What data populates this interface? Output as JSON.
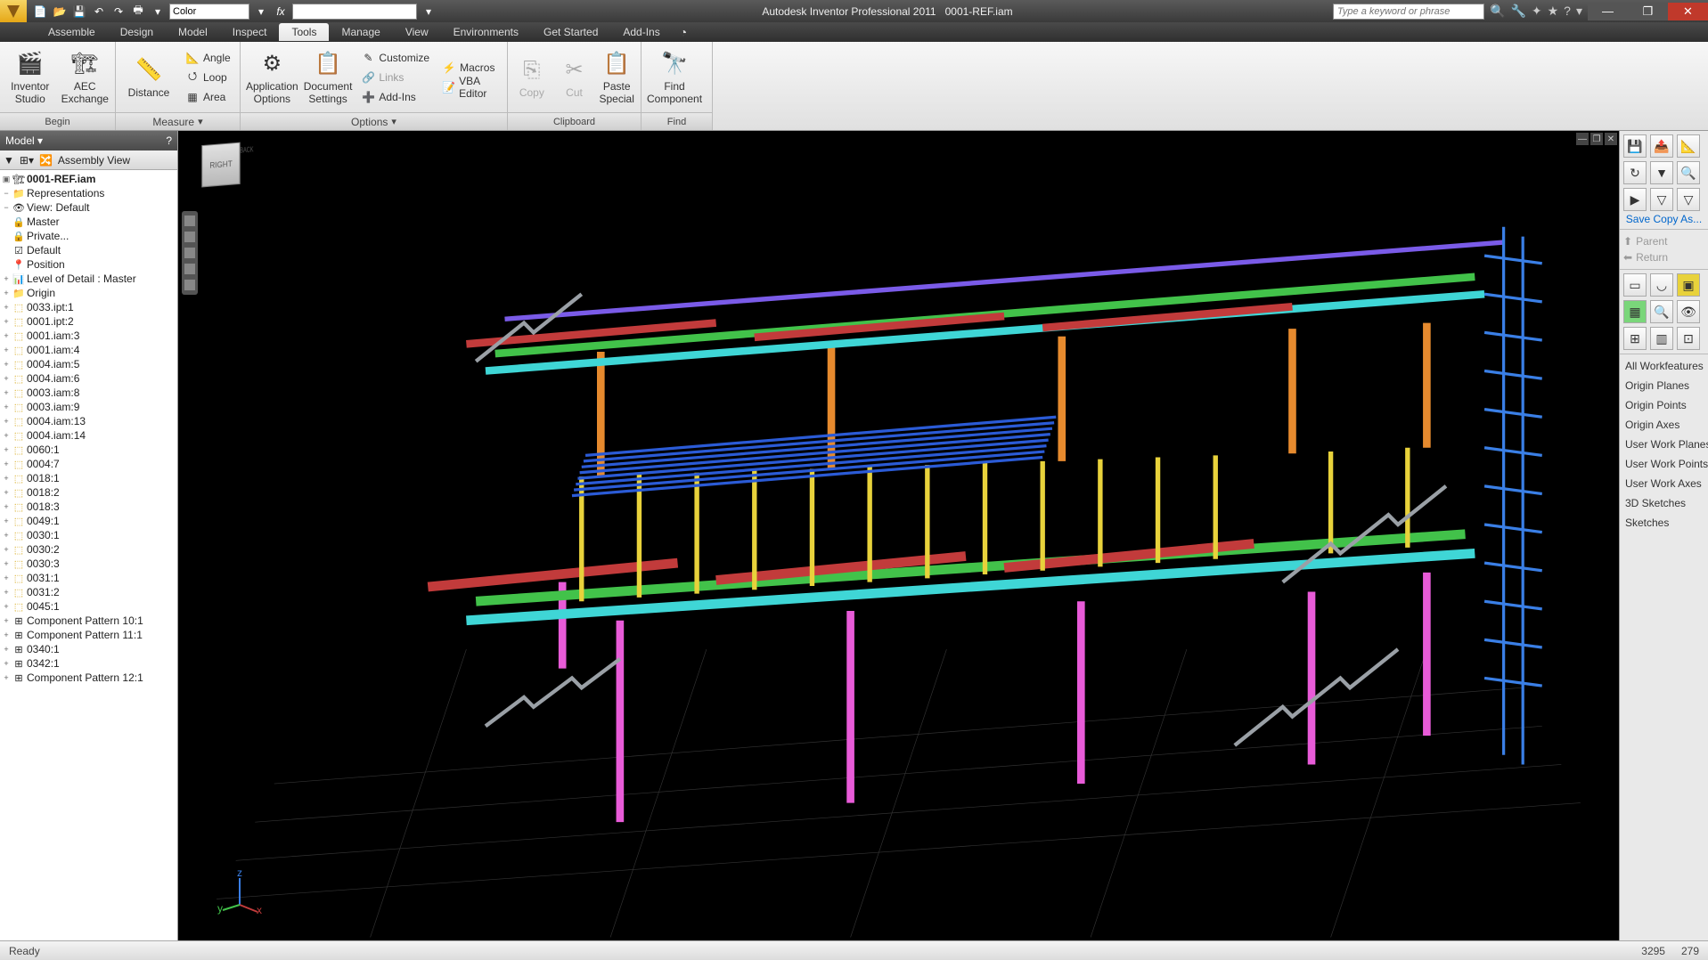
{
  "title": {
    "app": "Autodesk Inventor Professional 2011",
    "doc": "0001-REF.iam"
  },
  "qat": {
    "color_combo": "Color"
  },
  "search": {
    "placeholder": "Type a keyword or phrase"
  },
  "tabs": [
    "Assemble",
    "Design",
    "Model",
    "Inspect",
    "Tools",
    "Manage",
    "View",
    "Environments",
    "Get Started",
    "Add-Ins"
  ],
  "tabs_active": 4,
  "ribbon": {
    "begin": {
      "label": "Begin",
      "studio": "Inventor\nStudio",
      "aec": "AEC\nExchange"
    },
    "measure": {
      "label": "Measure",
      "distance": "Distance",
      "angle": "Angle",
      "loop": "Loop",
      "area": "Area"
    },
    "options": {
      "label": "Options",
      "appopts": "Application\nOptions",
      "docset": "Document\nSettings",
      "customize": "Customize",
      "links": "Links",
      "addins": "Add-Ins",
      "macros": "Macros",
      "vba": "VBA Editor"
    },
    "clipboard": {
      "label": "Clipboard",
      "copy": "Copy",
      "cut": "Cut",
      "paste": "Paste\nSpecial"
    },
    "find": {
      "label": "Find",
      "find": "Find\nComponent"
    }
  },
  "browser": {
    "title": "Model",
    "view_label": "Assembly View",
    "root": "0001-REF.iam",
    "reps": "Representations",
    "view_default": "View: Default",
    "master": "Master",
    "private": "Private...",
    "default": "Default",
    "position": "Position",
    "lod": "Level of Detail : Master",
    "origin": "Origin",
    "parts": [
      "0033.ipt:1",
      "0001.ipt:2",
      "0001.iam:3",
      "0001.iam:4",
      "0004.iam:5",
      "0004.iam:6",
      "0003.iam:8",
      "0003.iam:9",
      "0004.iam:13",
      "0004.iam:14",
      "0060:1",
      "0004:7",
      "0018:1",
      "0018:2",
      "0018:3",
      "0049:1",
      "0030:1",
      "0030:2",
      "0030:3",
      "0031:1",
      "0031:2",
      "0045:1"
    ],
    "patterns": [
      "Component Pattern 10:1",
      "Component Pattern 11:1",
      "0340:1",
      "0342:1",
      "Component Pattern 12:1"
    ]
  },
  "viewcube": {
    "face": "RIGHT"
  },
  "rightcol": {
    "savecopy": "Save Copy As...",
    "parent": "Parent",
    "return": "Return",
    "workfeatures": [
      "All Workfeatures",
      "Origin Planes",
      "Origin Points",
      "Origin Axes",
      "User Work Planes",
      "User Work Points",
      "User Work Axes",
      "3D Sketches",
      "Sketches"
    ]
  },
  "status": {
    "ready": "Ready",
    "x": "3295",
    "y": "279"
  }
}
